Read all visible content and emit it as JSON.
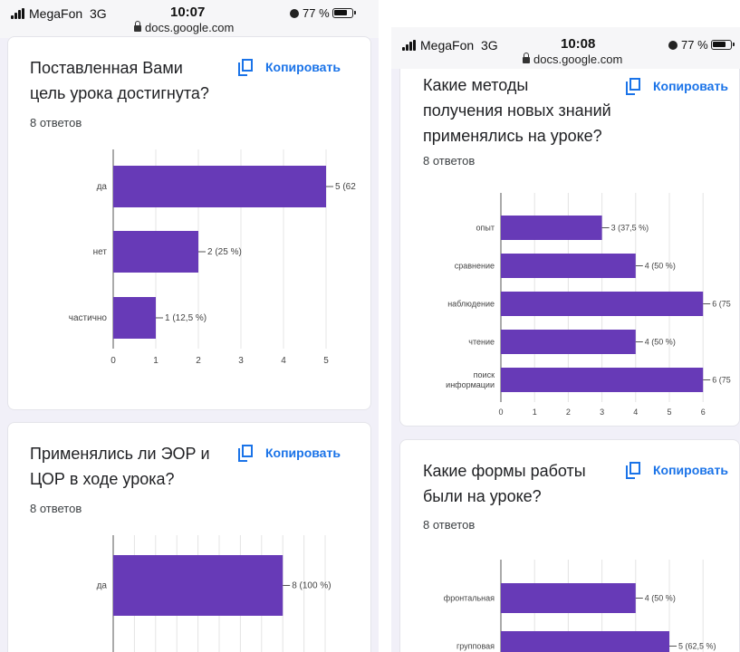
{
  "left_phone": {
    "status": {
      "carrier": "MegaFon",
      "network": "3G",
      "time": "10:07",
      "url": "docs.google.com",
      "battery": "77 %"
    }
  },
  "right_phone": {
    "status": {
      "carrier": "MegaFon",
      "network": "3G",
      "time": "10:08",
      "url": "docs.google.com",
      "battery": "77 %"
    }
  },
  "copy_label": "Копировать",
  "questions": [
    {
      "id": "q1",
      "title_lines": [
        "Поставленная Вами",
        "цель урока достигнута?"
      ],
      "count": "8 ответов"
    },
    {
      "id": "q2",
      "title_lines": [
        "Применялись ли ЭОР и",
        "ЦОР в ходе урока?"
      ],
      "count": "8 ответов"
    },
    {
      "id": "q3",
      "title_lines": [
        "Какие методы",
        "получения новых знаний",
        "применялись на уроке?"
      ],
      "count": "8 ответов"
    },
    {
      "id": "q4",
      "title_lines": [
        "Какие формы работы",
        "были на уроке?"
      ],
      "count": "8 ответов"
    }
  ],
  "colors": {
    "bar": "#673ab7",
    "accent": "#1a73e8",
    "page_bg": "#f1f0f8",
    "card_bg": "#ffffff"
  },
  "chart_data": [
    {
      "id": "q1",
      "type": "bar",
      "orientation": "horizontal",
      "categories": [
        "да",
        "нет",
        "частично"
      ],
      "values": [
        5,
        2,
        1
      ],
      "data_labels": [
        "5 (62",
        "2 (25 %)",
        "1 (12,5 %)"
      ],
      "xlim": [
        0,
        5
      ],
      "xticks": [
        "0",
        "1",
        "2",
        "3",
        "4",
        "5"
      ],
      "grid": true
    },
    {
      "id": "q2",
      "type": "bar",
      "orientation": "horizontal",
      "categories": [
        "да"
      ],
      "values": [
        8
      ],
      "data_labels": [
        "8 (100 %)"
      ],
      "xlim": [
        0,
        10
      ],
      "grid": true
    },
    {
      "id": "q3",
      "type": "bar",
      "orientation": "horizontal",
      "categories": [
        "опыт",
        "сравнение",
        "наблюдение",
        "чтение",
        "поиск информации"
      ],
      "category_lines": [
        [
          "опыт"
        ],
        [
          "сравнение"
        ],
        [
          "наблюдение"
        ],
        [
          "чтение"
        ],
        [
          "поиск",
          "информации"
        ]
      ],
      "values": [
        3,
        4,
        6,
        4,
        6
      ],
      "data_labels": [
        "3 (37,5 %)",
        "4 (50 %)",
        "6 (75",
        "4 (50 %)",
        "6 (75"
      ],
      "xlim": [
        0,
        6
      ],
      "xticks": [
        "0",
        "1",
        "2",
        "3",
        "4",
        "5",
        "6"
      ],
      "grid": true
    },
    {
      "id": "q4",
      "type": "bar",
      "orientation": "horizontal",
      "categories": [
        "фронтальная",
        "групповая"
      ],
      "values": [
        4,
        5
      ],
      "data_labels": [
        "4 (50 %)",
        "5 (62,5 %)"
      ],
      "xlim": [
        0,
        6
      ],
      "grid": true
    }
  ]
}
